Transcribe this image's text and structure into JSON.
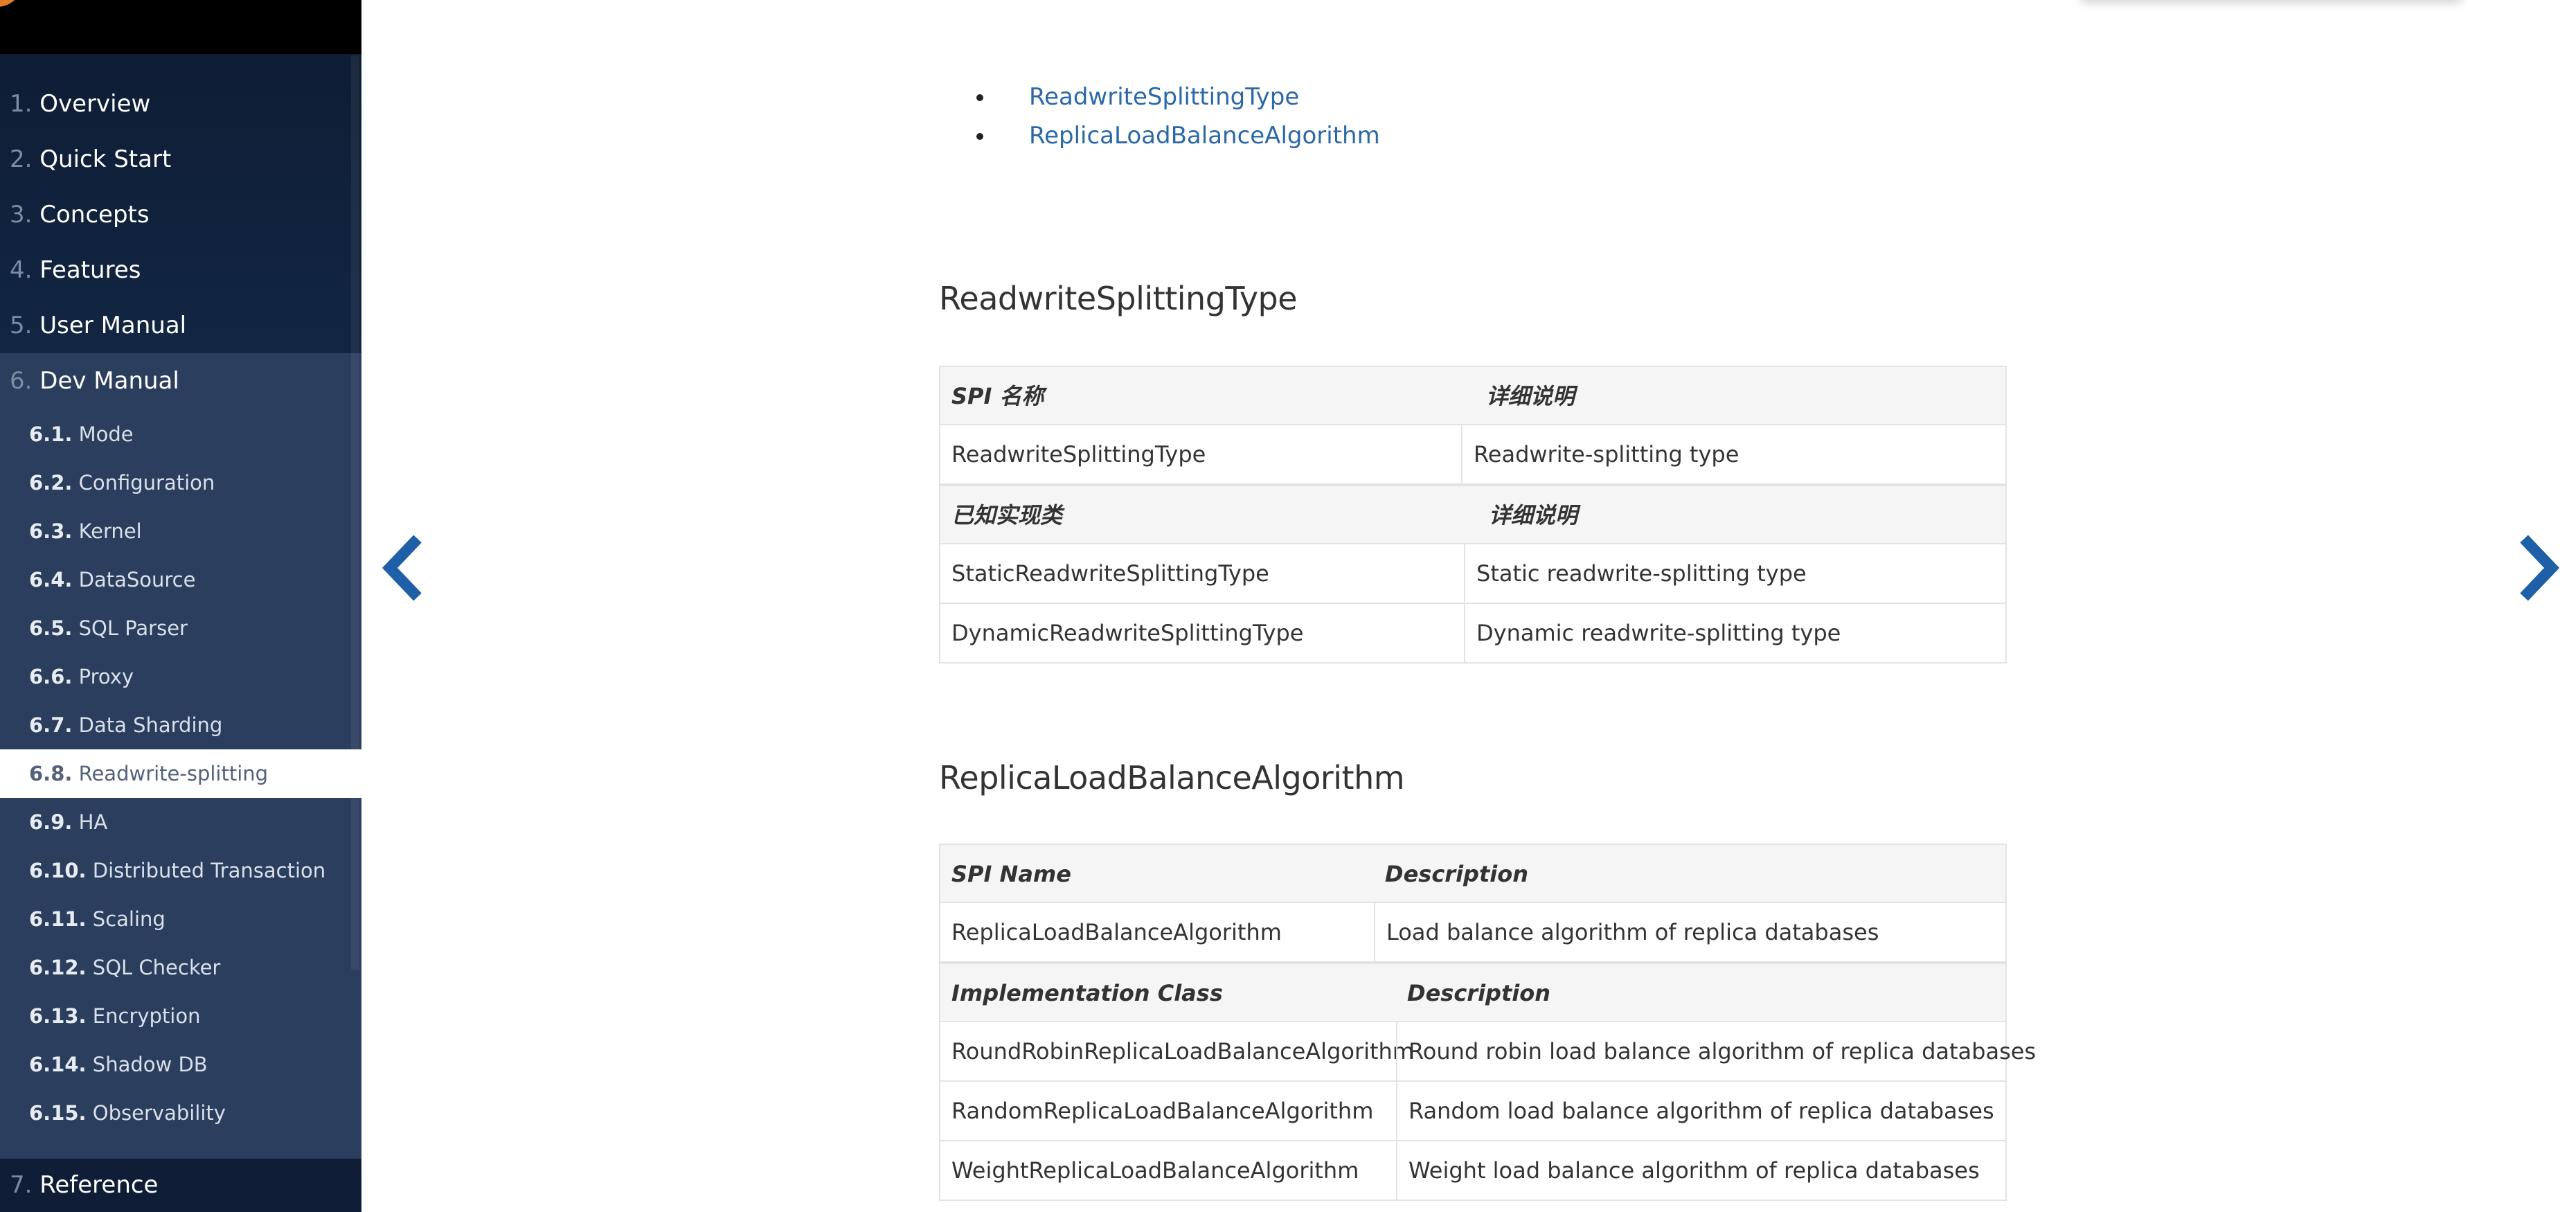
{
  "sidebar": {
    "top_items": [
      {
        "num": "1.",
        "label": "Overview"
      },
      {
        "num": "2.",
        "label": "Quick Start"
      },
      {
        "num": "3.",
        "label": "Concepts"
      },
      {
        "num": "4.",
        "label": "Features"
      },
      {
        "num": "5.",
        "label": "User Manual"
      },
      {
        "num": "6.",
        "label": "Dev Manual"
      }
    ],
    "sub_items": [
      {
        "num": "6.1.",
        "label": "Mode"
      },
      {
        "num": "6.2.",
        "label": "Configuration"
      },
      {
        "num": "6.3.",
        "label": "Kernel"
      },
      {
        "num": "6.4.",
        "label": "DataSource"
      },
      {
        "num": "6.5.",
        "label": "SQL Parser"
      },
      {
        "num": "6.6.",
        "label": "Proxy"
      },
      {
        "num": "6.7.",
        "label": "Data Sharding"
      },
      {
        "num": "6.8.",
        "label": "Readwrite-splitting"
      },
      {
        "num": "6.9.",
        "label": "HA"
      },
      {
        "num": "6.10.",
        "label": "Distributed Transaction"
      },
      {
        "num": "6.11.",
        "label": "Scaling"
      },
      {
        "num": "6.12.",
        "label": "SQL Checker"
      },
      {
        "num": "6.13.",
        "label": "Encryption"
      },
      {
        "num": "6.14.",
        "label": "Shadow DB"
      },
      {
        "num": "6.15.",
        "label": "Observability"
      }
    ],
    "active_sub": "6.8.",
    "reference": {
      "num": "7.",
      "label": "Reference"
    }
  },
  "toc": [
    "ReadwriteSplittingType",
    "ReplicaLoadBalanceAlgorithm"
  ],
  "sections": [
    {
      "title": "ReadwriteSplittingType",
      "spi_header": [
        "SPI 名称",
        "详细说明"
      ],
      "spi_rows": [
        [
          "ReadwriteSplittingType",
          "Readwrite-splitting type"
        ]
      ],
      "impl_header": [
        "已知实现类",
        "详细说明"
      ],
      "impl_rows": [
        [
          "StaticReadwriteSplittingType",
          "Static readwrite-splitting type"
        ],
        [
          "DynamicReadwriteSplittingType",
          "Dynamic readwrite-splitting type"
        ]
      ]
    },
    {
      "title": "ReplicaLoadBalanceAlgorithm",
      "spi_header": [
        "SPI Name",
        "Description"
      ],
      "spi_rows": [
        [
          "ReplicaLoadBalanceAlgorithm",
          "Load balance algorithm of replica databases"
        ]
      ],
      "impl_header": [
        "Implementation Class",
        "Description"
      ],
      "impl_rows": [
        [
          "RoundRobinReplicaLoadBalanceAlgorithm",
          "Round robin load balance algorithm of replica databases"
        ],
        [
          "RandomReplicaLoadBalanceAlgorithm",
          "Random load balance algorithm of replica databases"
        ],
        [
          "WeightReplicaLoadBalanceAlgorithm",
          "Weight load balance algorithm of replica databases"
        ]
      ]
    }
  ],
  "colors": {
    "link": "#2a68a8",
    "arrow": "#1f5fa8",
    "sidebar_active_bg": "#ffffff"
  },
  "icons": {
    "prev": "chevron-left-icon",
    "next": "chevron-right-icon"
  }
}
